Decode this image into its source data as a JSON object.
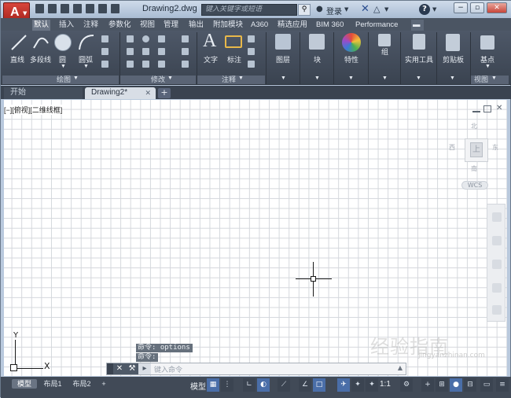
{
  "window": {
    "doc_title": "Drawing2.dwg",
    "search_placeholder": "键入关键字或短语",
    "login": "登录",
    "minimize": "−",
    "restore": "▫",
    "close": "✕"
  },
  "app_menu": {
    "logo": "A"
  },
  "ribbon_tabs": [
    "默认",
    "插入",
    "注释",
    "参数化",
    "视图",
    "管理",
    "输出",
    "附加模块",
    "A360",
    "精选应用",
    "BIM 360",
    "Performance"
  ],
  "ribbon": {
    "draw": {
      "line": "直线",
      "polyline": "多段线",
      "circle": "圆",
      "arc": "圆弧",
      "title": "绘图"
    },
    "modify": {
      "title": "修改"
    },
    "annotation": {
      "text": "文字",
      "dimension": "标注",
      "title": "注释"
    },
    "layers": {
      "label": "图层"
    },
    "block": {
      "label": "块"
    },
    "properties": {
      "label": "特性"
    },
    "groups": {
      "label": "组"
    },
    "utilities": {
      "label": "实用工具"
    },
    "clipboard": {
      "label": "剪贴板"
    },
    "view": {
      "base": "基点",
      "title": "视图"
    }
  },
  "doc_tabs": {
    "start": "开始",
    "active": "Drawing2*",
    "add": "+"
  },
  "viewport": {
    "label": "[−][俯视][二维线框]",
    "viewcube": {
      "face": "上",
      "north": "北",
      "south": "南",
      "east": "东",
      "west": "西",
      "wcs": "WCS"
    },
    "ucs": {
      "x": "X",
      "y": "Y"
    }
  },
  "command": {
    "history": [
      "命令: options",
      "命令:"
    ],
    "placeholder": "键入命令"
  },
  "watermark": {
    "main": "经验指南",
    "sub": "jingyanzhinan.com"
  },
  "status": {
    "layout_tabs": [
      "模型",
      "布局1",
      "布局2"
    ],
    "add": "+",
    "model": "模型",
    "scale": "1:1"
  }
}
